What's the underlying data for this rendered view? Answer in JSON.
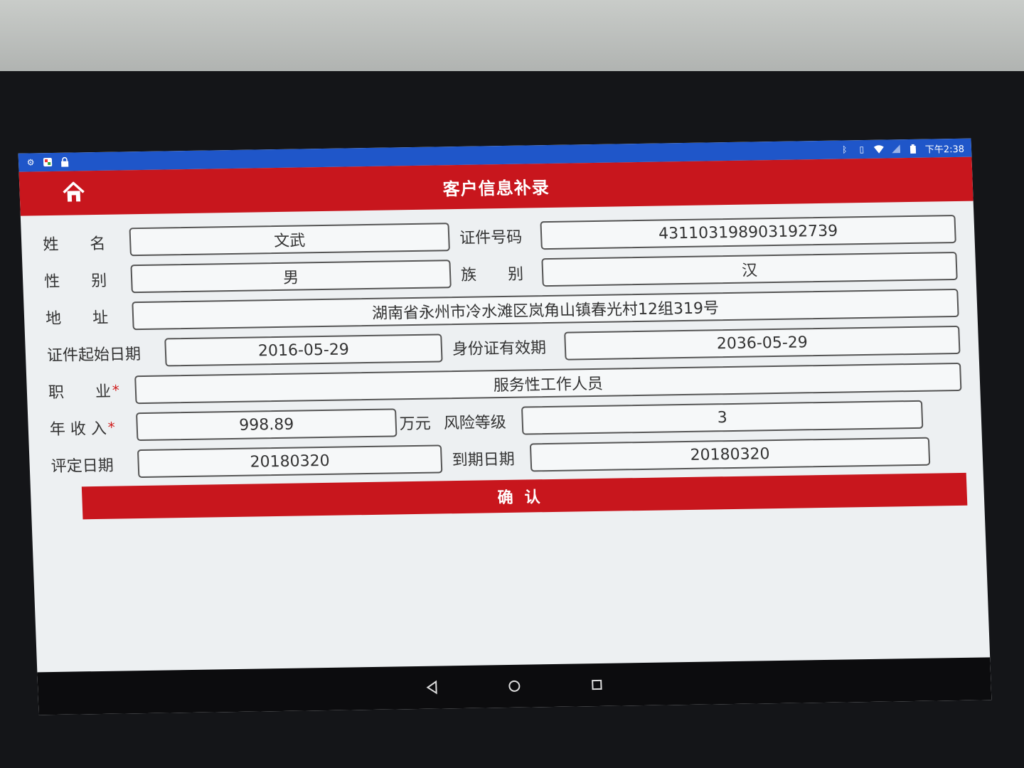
{
  "status_bar": {
    "left_icons": [
      "settings-icon",
      "app-icon",
      "lock-icon"
    ],
    "right_icons": [
      "bluetooth-icon",
      "vibrate-icon",
      "wifi-icon",
      "signal-icon",
      "battery-icon"
    ],
    "time": "下午2:38"
  },
  "header": {
    "title": "客户信息补录",
    "home_icon": "home-icon"
  },
  "form": {
    "name_label": "姓　　名",
    "name_value": "文武",
    "id_number_label": "证件号码",
    "id_number_value": "431103198903192739",
    "gender_label": "性　　别",
    "gender_value": "男",
    "ethnicity_label": "族　　别",
    "ethnicity_value": "汉",
    "address_label": "地　　址",
    "address_value": "湖南省永州市冷水滩区岚角山镇春光村12组319号",
    "id_start_label": "证件起始日期",
    "id_start_value": "2016-05-29",
    "id_valid_label": "身份证有效期",
    "id_valid_value": "2036-05-29",
    "occupation_label": "职　　业",
    "occupation_value": "服务性工作人员",
    "income_label": "年 收 入",
    "income_value": "998.89",
    "income_unit": "万元",
    "risk_label": "风险等级",
    "risk_value": "3",
    "assess_date_label": "评定日期",
    "assess_date_value": "20180320",
    "expire_date_label": "到期日期",
    "expire_date_value": "20180320",
    "required_mark": "*"
  },
  "confirm_button": "确认",
  "nav_bar": [
    "back-icon",
    "home-circle-icon",
    "recents-icon"
  ],
  "colors": {
    "status_bar": "#1f56c9",
    "title_bar": "#c8161d",
    "button": "#c8161d",
    "background": "#edf0f2"
  }
}
